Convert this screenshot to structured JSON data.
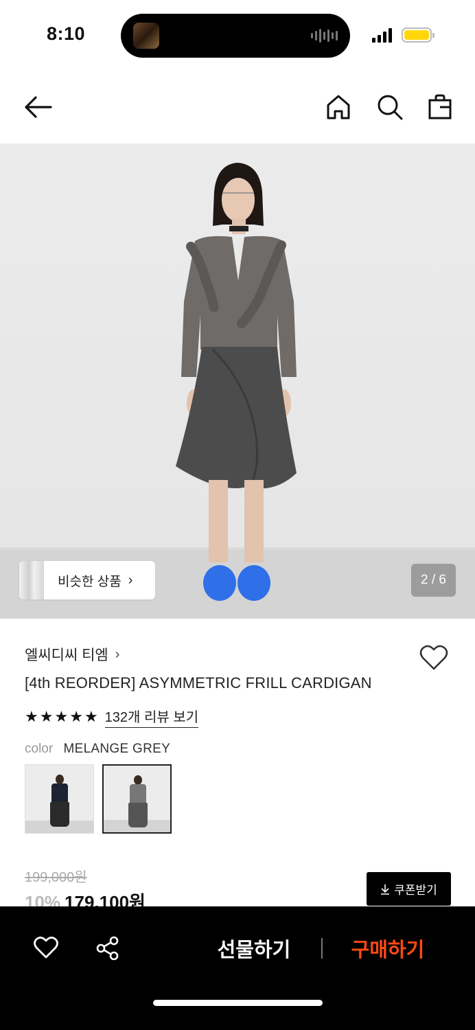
{
  "status_bar": {
    "time": "8:10"
  },
  "nav": {
    "back_icon": "arrow-left-icon",
    "home_icon": "home-icon",
    "search_icon": "search-icon",
    "bag_icon": "shopping-bag-icon"
  },
  "hero": {
    "similar_products_label": "비슷한 상품",
    "page_counter": "2 / 6"
  },
  "product": {
    "brand": "엘씨디씨 티엠",
    "name": "[4th REORDER] ASYMMETRIC FRILL CARDIGAN",
    "rating_stars": 5,
    "review_link": "132개 리뷰 보기",
    "color_label": "color",
    "color_value": "MELANGE GREY",
    "swatches": [
      "navy",
      "melange-grey"
    ],
    "selected_swatch": "melange-grey",
    "original_price": "199,000원",
    "discount": "10%",
    "price": "179,100원",
    "coupon_label": "쿠폰받기"
  },
  "bottom_bar": {
    "gift_label": "선물하기",
    "buy_label": "구매하기",
    "buy_color": "#ff4a14"
  }
}
